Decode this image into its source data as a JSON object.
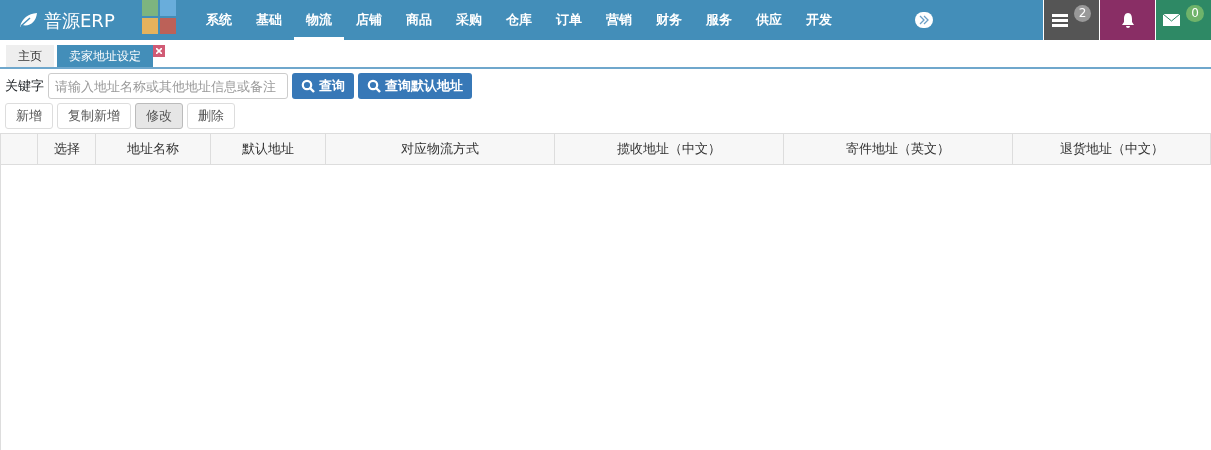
{
  "brand": {
    "name": "普源ERP"
  },
  "nav": [
    {
      "label": "系统",
      "selected": false
    },
    {
      "label": "基础",
      "selected": false
    },
    {
      "label": "物流",
      "selected": true
    },
    {
      "label": "店铺",
      "selected": false
    },
    {
      "label": "商品",
      "selected": false
    },
    {
      "label": "采购",
      "selected": false
    },
    {
      "label": "仓库",
      "selected": false
    },
    {
      "label": "订单",
      "selected": false
    },
    {
      "label": "营销",
      "selected": false
    },
    {
      "label": "财务",
      "selected": false
    },
    {
      "label": "服务",
      "selected": false
    },
    {
      "label": "供应",
      "selected": false
    },
    {
      "label": "开发",
      "selected": false
    }
  ],
  "indicators": [
    {
      "kind": "tasks",
      "count": "2"
    },
    {
      "kind": "alerts"
    },
    {
      "kind": "messages",
      "count": "0"
    }
  ],
  "tabs": [
    {
      "label": "主页",
      "selected": false,
      "closable": false
    },
    {
      "label": "卖家地址设定",
      "selected": true,
      "closable": true
    }
  ],
  "search": {
    "label": "关键字",
    "placeholder": "请输入地址名称或其他地址信息或备注"
  },
  "search_buttons": [
    "查询",
    "查询默认地址"
  ],
  "actions": [
    {
      "label": "新增",
      "pressed": false
    },
    {
      "label": "复制新增",
      "pressed": false
    },
    {
      "label": "修改",
      "pressed": true
    },
    {
      "label": "删除",
      "pressed": false
    }
  ],
  "table": {
    "columns": [
      "",
      "选择",
      "地址名称",
      "默认地址",
      "对应物流方式",
      "揽收地址（中文）",
      "寄件地址（英文）",
      "退货地址（中文）"
    ]
  }
}
